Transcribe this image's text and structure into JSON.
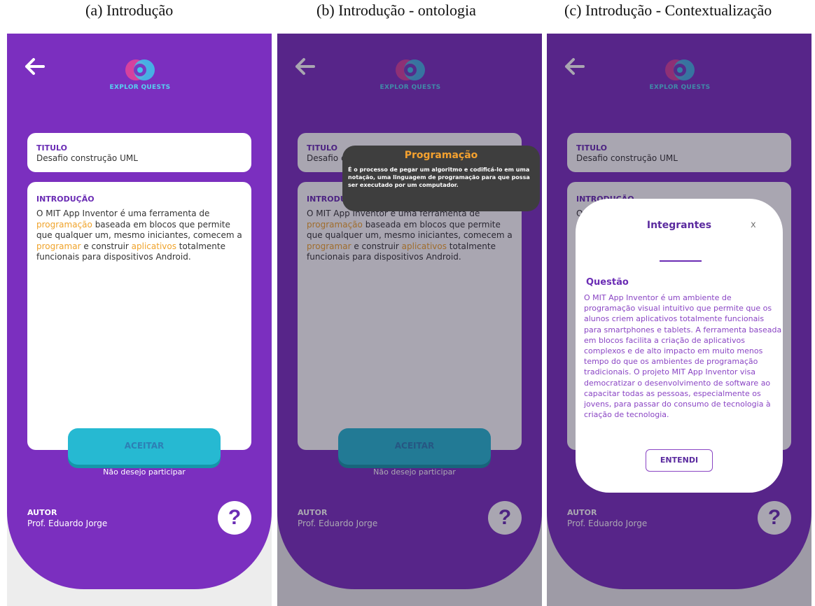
{
  "captions": [
    "(a) Introdução",
    "(b) Introdução - ontologia",
    "(c) Introdução - Contextualização"
  ],
  "app": {
    "logo_text": "EXPLOR QUESTS"
  },
  "title_card": {
    "label": "TITULO",
    "value": "Desafio construção UML"
  },
  "intro_card": {
    "label": "INTRODUÇÃO",
    "segments": [
      {
        "text": "O MIT App Inventor é uma ferramenta de ",
        "highlight": false
      },
      {
        "text": "programação",
        "highlight": true
      },
      {
        "text": " baseada em blocos que permite que qualquer um, mesmo iniciantes, comecem a ",
        "highlight": false
      },
      {
        "text": "programar",
        "highlight": true
      },
      {
        "text": " e construir ",
        "highlight": false
      },
      {
        "text": "aplicativos",
        "highlight": true
      },
      {
        "text": " totalmente funcionais para dispositivos Android.",
        "highlight": false
      }
    ]
  },
  "actions": {
    "accept": "ACEITAR",
    "decline": "Não desejo participar"
  },
  "author": {
    "label": "AUTOR",
    "name": "Prof. Eduardo Jorge"
  },
  "help_symbol": "?",
  "tooltip": {
    "title": "Programação",
    "body": "É o processo de pegar um algoritmo e codificá-lo em uma notação, uma linguagem de programação para que possa ser executado por um computador."
  },
  "modal": {
    "title": "Integrantes",
    "close": "x",
    "question_label": "Questão",
    "text": "O MIT App Inventor é um ambiente de programação visual intuitivo que permite que os alunos criem aplicativos totalmente funcionais para smartphones e tablets. A ferramenta baseada em blocos facilita a criação de aplicativos complexos e de alto impacto em muito menos tempo do que os ambientes de programação tradicionais. O projeto MIT App Inventor visa democratizar o desenvolvimento de software ao capacitar todas as pessoas, especialmente os jovens, para passar do consumo de tecnologia à criação de tecnologia.",
    "button": "ENTENDI"
  },
  "colors": {
    "purple": "#7b2fbf",
    "cyan": "#26b9d2",
    "highlight": "#f0a32a",
    "tooltip_bg": "#3e3e3e"
  },
  "icons": [
    "back-arrow-icon",
    "explor-quests-logo",
    "help-icon",
    "close-icon"
  ]
}
